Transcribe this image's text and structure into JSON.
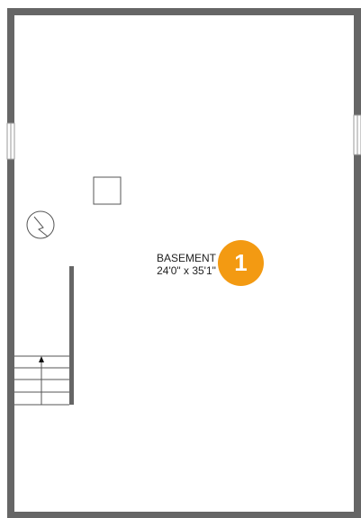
{
  "room": {
    "name": "BASEMENT",
    "dimensions": "24'0\" x 35'1\""
  },
  "badge": {
    "number": "1",
    "color": "#f39a12"
  },
  "icons": [
    "water-heater-icon",
    "square-fixture-icon",
    "stairs-up-arrow-icon"
  ]
}
